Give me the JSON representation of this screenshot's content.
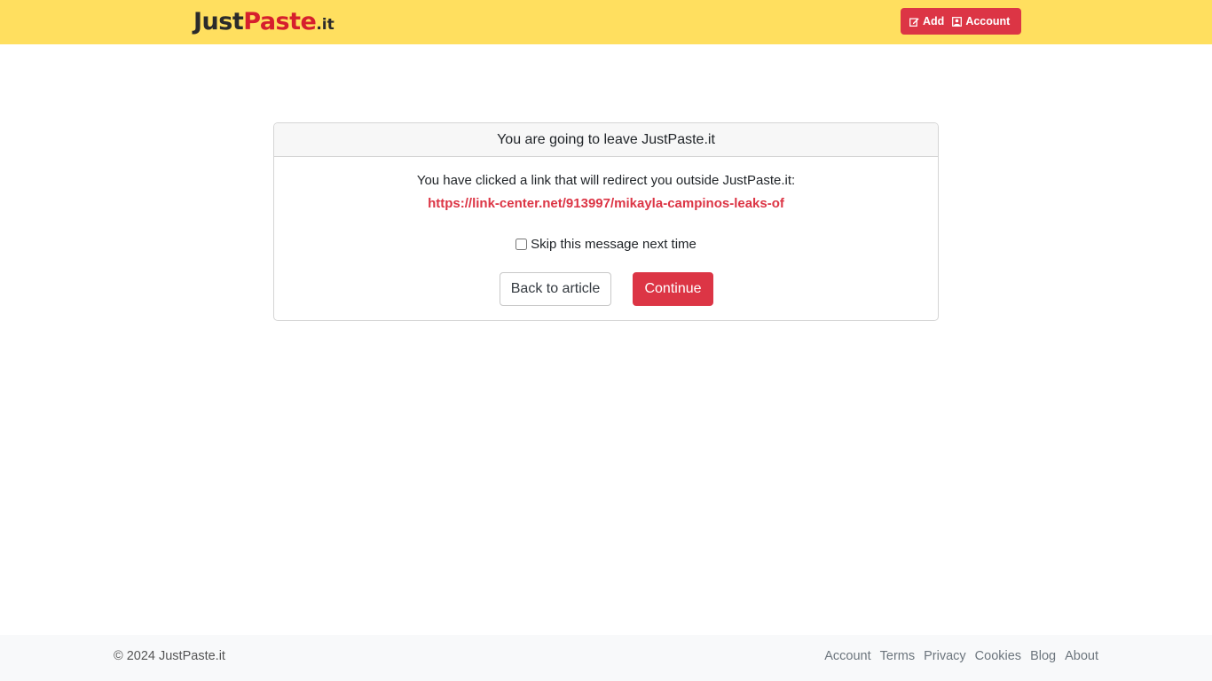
{
  "header": {
    "logo": {
      "part1": "Just",
      "part2": "Paste",
      "part3": ".it"
    },
    "add_label": "Add",
    "add_icon": "edit-icon",
    "account_label": "Account",
    "account_icon": "user-icon",
    "brand_color": "#ffdf5f",
    "accent_color": "#dc3545"
  },
  "dialog": {
    "title": "You are going to leave JustPaste.it",
    "message": "You have clicked a link that will redirect you outside JustPaste.it:",
    "url": "https://link-center.net/913997/mikayla-campinos-leaks-of",
    "skip_label": "Skip this message next time",
    "skip_checked": false,
    "back_label": "Back to article",
    "continue_label": "Continue"
  },
  "footer": {
    "copyright": "© 2024 JustPaste.it",
    "links": [
      "Account",
      "Terms",
      "Privacy",
      "Cookies",
      "Blog",
      "About"
    ]
  }
}
